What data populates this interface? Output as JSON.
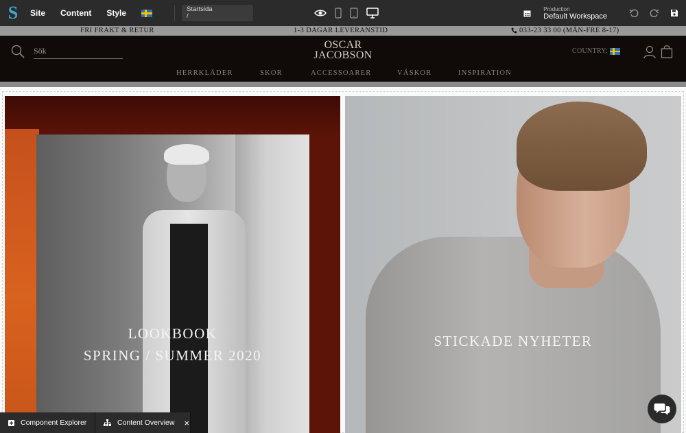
{
  "cms": {
    "logo": "S",
    "menu": [
      {
        "label": "Site"
      },
      {
        "label": "Content"
      },
      {
        "label": "Style"
      }
    ],
    "url_title": "Startsida",
    "url_path": "/",
    "environment": "Production",
    "workspace": "Default Workspace",
    "accent_color": "#3fa9c9"
  },
  "announcement": {
    "left": "FRI FRAKT & RETUR",
    "center": "1-3 DAGAR LEVERANSTID",
    "right": "033-23 33 00 (MÅN-FRE 8-17)"
  },
  "header": {
    "search_placeholder": "Sök",
    "brand_line1": "OSCAR",
    "brand_line2": "JACOBSON",
    "country_label": "COUNTRY:",
    "nav": [
      {
        "label": "HERRKLÄDER"
      },
      {
        "label": "SKOR"
      },
      {
        "label": "ACCESSOARER"
      },
      {
        "label": "VÄSKOR"
      },
      {
        "label": "INSPIRATION"
      }
    ]
  },
  "tiles": [
    {
      "line1": "LOOKBOOK",
      "line2": "SPRING / SUMMER 2020"
    },
    {
      "line1": "STICKADE NYHETER"
    }
  ],
  "panels": [
    {
      "label": "Component Explorer",
      "icon": "plus-square-icon"
    },
    {
      "label": "Content Overview",
      "icon": "sitemap-icon"
    }
  ]
}
